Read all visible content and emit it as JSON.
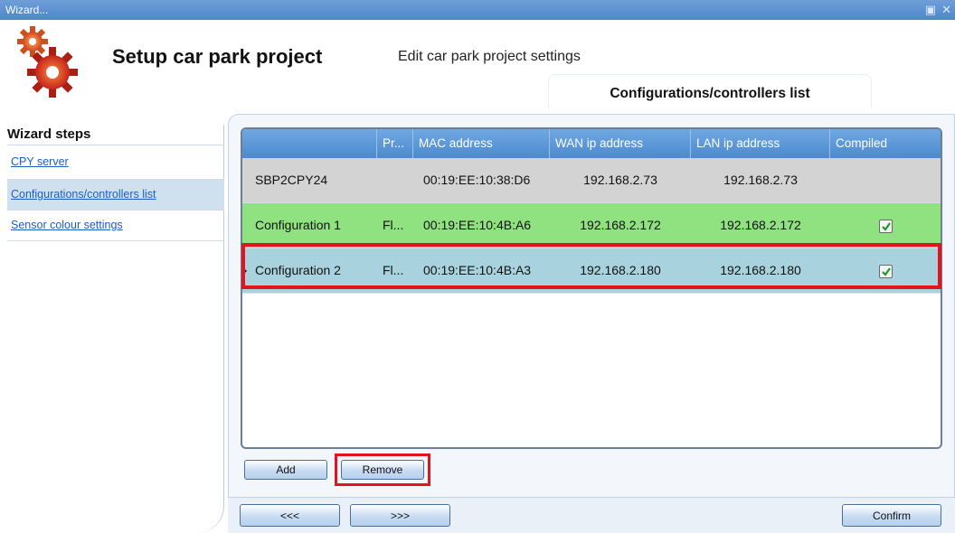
{
  "window": {
    "title": "Wizard..."
  },
  "header": {
    "title": "Setup car park project",
    "subtitle": "Edit car park project settings",
    "active_tab": "Configurations/controllers list"
  },
  "sidebar": {
    "title": "Wizard steps",
    "items": [
      {
        "label": "CPY server",
        "selected": false
      },
      {
        "label": "Configurations/controllers list",
        "selected": true
      },
      {
        "label": "Sensor colour settings",
        "selected": false
      }
    ]
  },
  "grid": {
    "columns": [
      "",
      "Pr...",
      "MAC address",
      "WAN ip address",
      "LAN ip address",
      "Compiled"
    ],
    "rows": [
      {
        "name": "SBP2CPY24",
        "pr": "",
        "mac": "00:19:EE:10:38:D6",
        "wan": "192.168.2.73",
        "lan": "192.168.2.73",
        "compiled": null,
        "style": "gray"
      },
      {
        "name": "Configuration 1",
        "pr": "Fl...",
        "mac": "00:19:EE:10:4B:A6",
        "wan": "192.168.2.172",
        "lan": "192.168.2.172",
        "compiled": true,
        "style": "green"
      },
      {
        "name": "Configuration 2",
        "pr": "Fl...",
        "mac": "00:19:EE:10:4B:A3",
        "wan": "192.168.2.180",
        "lan": "192.168.2.180",
        "compiled": true,
        "style": "selected"
      }
    ]
  },
  "buttons": {
    "add": "Add",
    "remove": "Remove",
    "prev": "<<<",
    "next": ">>>",
    "confirm": "Confirm"
  },
  "colors": {
    "titlebar": "#5b8fd0",
    "grid_header": "#5e99d9",
    "row_gray": "#d3d3d3",
    "row_green": "#8fe27f",
    "row_selected": "#a8d3de",
    "highlight": "#e3141e"
  }
}
